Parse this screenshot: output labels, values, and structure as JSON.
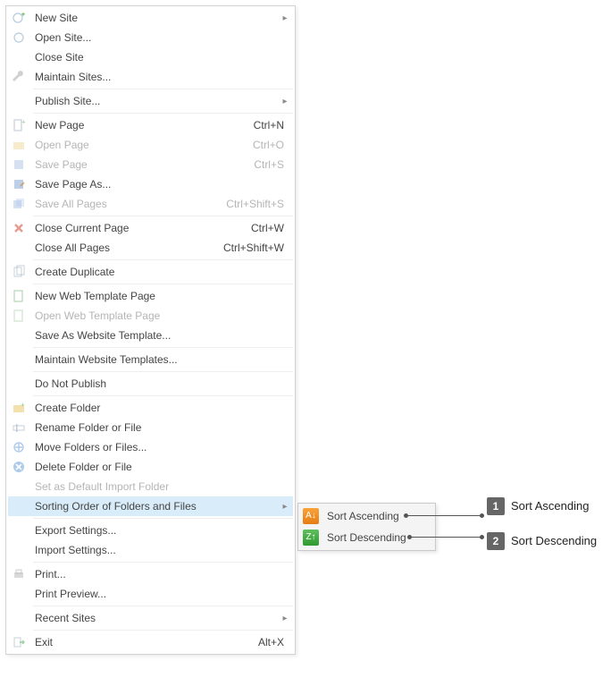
{
  "menu": {
    "groups": [
      [
        {
          "id": "new-site",
          "label": "New Site",
          "icon": "globe-plus",
          "submenu": true
        },
        {
          "id": "open-site",
          "label": "Open Site...",
          "icon": "globe-open"
        },
        {
          "id": "close-site",
          "label": "Close Site"
        },
        {
          "id": "maintain-sites",
          "label": "Maintain Sites...",
          "icon": "wrench"
        }
      ],
      [
        {
          "id": "publish-site",
          "label": "Publish Site...",
          "submenu": true
        }
      ],
      [
        {
          "id": "new-page",
          "label": "New Page",
          "icon": "page-plus",
          "shortcut": "Ctrl+N"
        },
        {
          "id": "open-page",
          "label": "Open Page",
          "icon": "page-folder",
          "shortcut": "Ctrl+O",
          "disabled": true
        },
        {
          "id": "save-page",
          "label": "Save Page",
          "icon": "disk",
          "shortcut": "Ctrl+S",
          "disabled": true
        },
        {
          "id": "save-page-as",
          "label": "Save Page As...",
          "icon": "disk-pencil"
        },
        {
          "id": "save-all-pages",
          "label": "Save All Pages",
          "icon": "disks",
          "shortcut": "Ctrl+Shift+S",
          "disabled": true
        }
      ],
      [
        {
          "id": "close-current-page",
          "label": "Close Current Page",
          "icon": "close-red",
          "shortcut": "Ctrl+W"
        },
        {
          "id": "close-all-pages",
          "label": "Close All Pages",
          "shortcut": "Ctrl+Shift+W"
        }
      ],
      [
        {
          "id": "create-duplicate",
          "label": "Create Duplicate",
          "icon": "duplicate"
        }
      ],
      [
        {
          "id": "new-web-template-page",
          "label": "New Web Template Page",
          "icon": "page-tpl"
        },
        {
          "id": "open-web-template-page",
          "label": "Open Web Template Page",
          "icon": "page-tpl-open",
          "disabled": true
        },
        {
          "id": "save-as-website-template",
          "label": "Save As Website Template..."
        }
      ],
      [
        {
          "id": "maintain-website-templates",
          "label": "Maintain Website Templates..."
        }
      ],
      [
        {
          "id": "do-not-publish",
          "label": "Do Not Publish"
        }
      ],
      [
        {
          "id": "create-folder",
          "label": "Create Folder",
          "icon": "folder-plus"
        },
        {
          "id": "rename-folder-file",
          "label": "Rename Folder or File",
          "icon": "rename"
        },
        {
          "id": "move-folders-files",
          "label": "Move Folders or Files...",
          "icon": "move"
        },
        {
          "id": "delete-folder-file",
          "label": "Delete Folder or File",
          "icon": "delete-blue"
        },
        {
          "id": "set-default-import-folder",
          "label": "Set as Default Import Folder",
          "disabled": true
        },
        {
          "id": "sorting-order",
          "label": "Sorting Order of Folders and Files",
          "submenu": true,
          "highlight": true
        }
      ],
      [
        {
          "id": "export-settings",
          "label": "Export Settings..."
        },
        {
          "id": "import-settings",
          "label": "Import Settings..."
        }
      ],
      [
        {
          "id": "print",
          "label": "Print...",
          "icon": "printer"
        },
        {
          "id": "print-preview",
          "label": "Print Preview..."
        }
      ],
      [
        {
          "id": "recent-sites",
          "label": "Recent Sites",
          "submenu": true
        }
      ],
      [
        {
          "id": "exit",
          "label": "Exit",
          "icon": "exit",
          "shortcut": "Alt+X"
        }
      ]
    ]
  },
  "submenu": {
    "items": [
      {
        "id": "sort-ascending",
        "label": "Sort Ascending",
        "iconClass": "sub-icon-asc",
        "glyph": "A↓"
      },
      {
        "id": "sort-descending",
        "label": "Sort Descending",
        "iconClass": "sub-icon-desc",
        "glyph": "Z↑"
      }
    ]
  },
  "callouts": [
    {
      "num": "1",
      "label": "Sort Ascending"
    },
    {
      "num": "2",
      "label": "Sort Descending"
    }
  ]
}
